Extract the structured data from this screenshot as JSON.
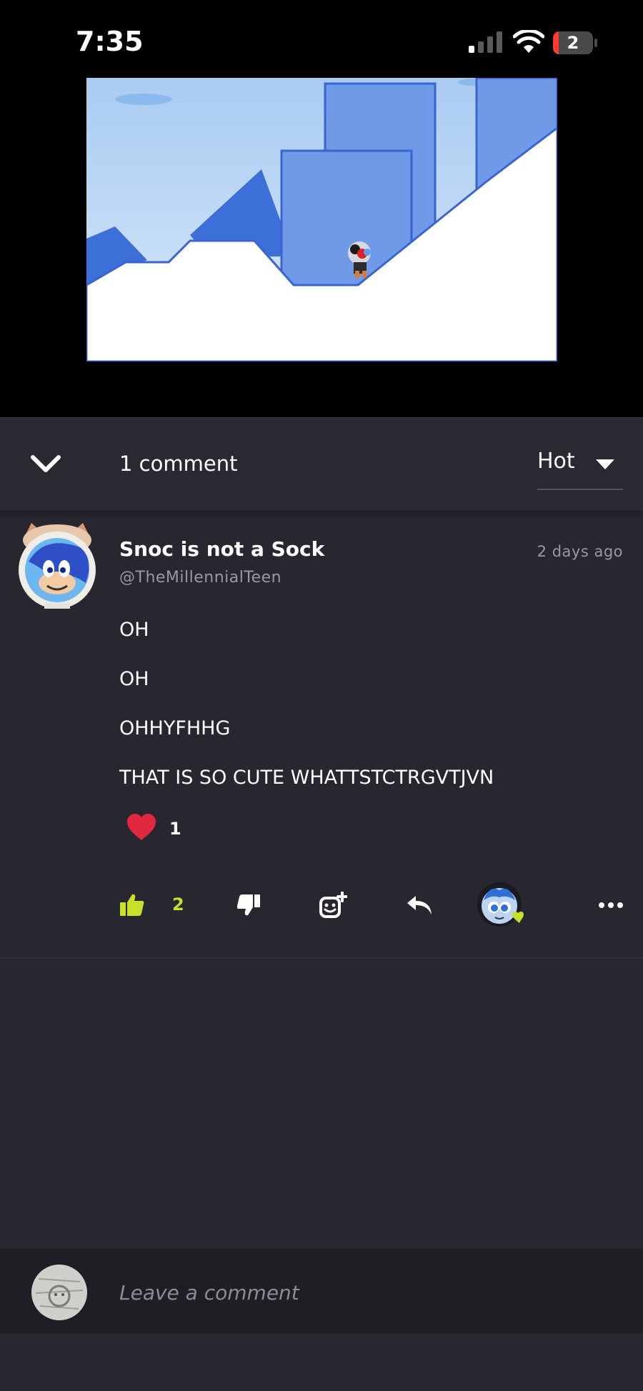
{
  "status_bar": {
    "time": "7:35",
    "battery_level": "2"
  },
  "comments_header": {
    "count_label": "1 comment",
    "sort_value": "Hot"
  },
  "comment": {
    "author": "Snoc is not a Sock",
    "handle": "@TheMillennialTeen",
    "timestamp": "2 days ago",
    "lines": [
      "OH",
      "OH",
      "OHHYFHHG",
      "THAT IS SO CUTE WHATTSTCTRGVTJVN"
    ],
    "reaction": {
      "icon": "heart-icon",
      "count": "1"
    },
    "likes": "2"
  },
  "composer": {
    "placeholder": "Leave a comment"
  },
  "colors": {
    "accent": "#c8e02a",
    "heart": "#e0293f",
    "background": "#28262f"
  }
}
